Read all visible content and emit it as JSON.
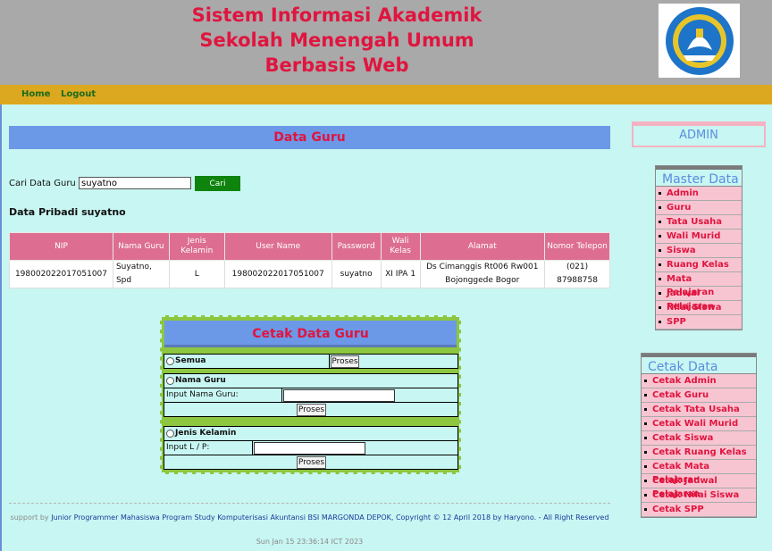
{
  "header": {
    "title_line1": "Sistem Informasi Akademik",
    "title_line2": "Sekolah Menengah Umum",
    "title_line3": "Berbasis Web",
    "logo_icon": "tut-wuri-handayani-logo"
  },
  "nav": {
    "home": "Home",
    "logout": "Logout"
  },
  "main": {
    "heading": "Data Guru",
    "search": {
      "label": "Cari Data Guru :",
      "value": "suyatno",
      "button": "Cari"
    },
    "section_title": "Data Pribadi suyatno",
    "table": {
      "headers": [
        "NIP",
        "Nama Guru",
        "Jenis Kelamin",
        "User Name",
        "Password",
        "Wali Kelas",
        "Alamat",
        "Nomor Telepon"
      ],
      "row": [
        "198002022017051007",
        "Suyatno, Spd",
        "L",
        "198002022017051007",
        "suyatno",
        "XI IPA 1",
        "Ds Cimanggis Rt006 Rw001 Bojonggede Bogor",
        "(021) 87988758"
      ]
    },
    "cetak": {
      "title": "Cetak Data Guru",
      "semua": "Semua",
      "proses": "Proses",
      "nama_guru": "Nama Guru",
      "input_nama": "Input Nama Guru:",
      "jenis_kelamin": "Jenis Kelamin",
      "input_lp": "Input L / P:"
    }
  },
  "footer": {
    "prefix": "support by",
    "text": "Junior Programmer Mahasiswa Program Study Komputerisasi Akuntansi BSI MARGONDA DEPOK, Copyright © 12 April 2018 by Haryono. - All Right Reserved",
    "date": "Sun Jan 15 23:36:14 ICT 2023"
  },
  "sidebar": {
    "admin": "ADMIN",
    "master_title": "Master Data",
    "master_items": [
      "Admin",
      "Guru",
      "Tata Usaha",
      "Wali Murid",
      "Siswa",
      "Ruang Kelas",
      "Mata Pelajaran",
      "Jadwal Pelajaran",
      "Nilai Siswa",
      "SPP"
    ],
    "cetak_title": "Cetak Data",
    "cetak_items": [
      "Cetak Admin",
      "Cetak Guru",
      "Cetak Tata Usaha",
      "Cetak Wali Murid",
      "Cetak Siswa",
      "Cetak Ruang Kelas",
      "Cetak Mata Pelajaran",
      "Cetak Jadwal Pelajaran",
      "Cetak Nilai Siswa",
      "Cetak SPP"
    ]
  },
  "colors": {
    "accent_red": "#e0153f",
    "header_grey": "#a9a9a9",
    "nav_gold": "#dca81f",
    "heading_blue": "#6c98e8",
    "background": "#c8f6f2",
    "menu_pink": "#f7c5d2"
  }
}
